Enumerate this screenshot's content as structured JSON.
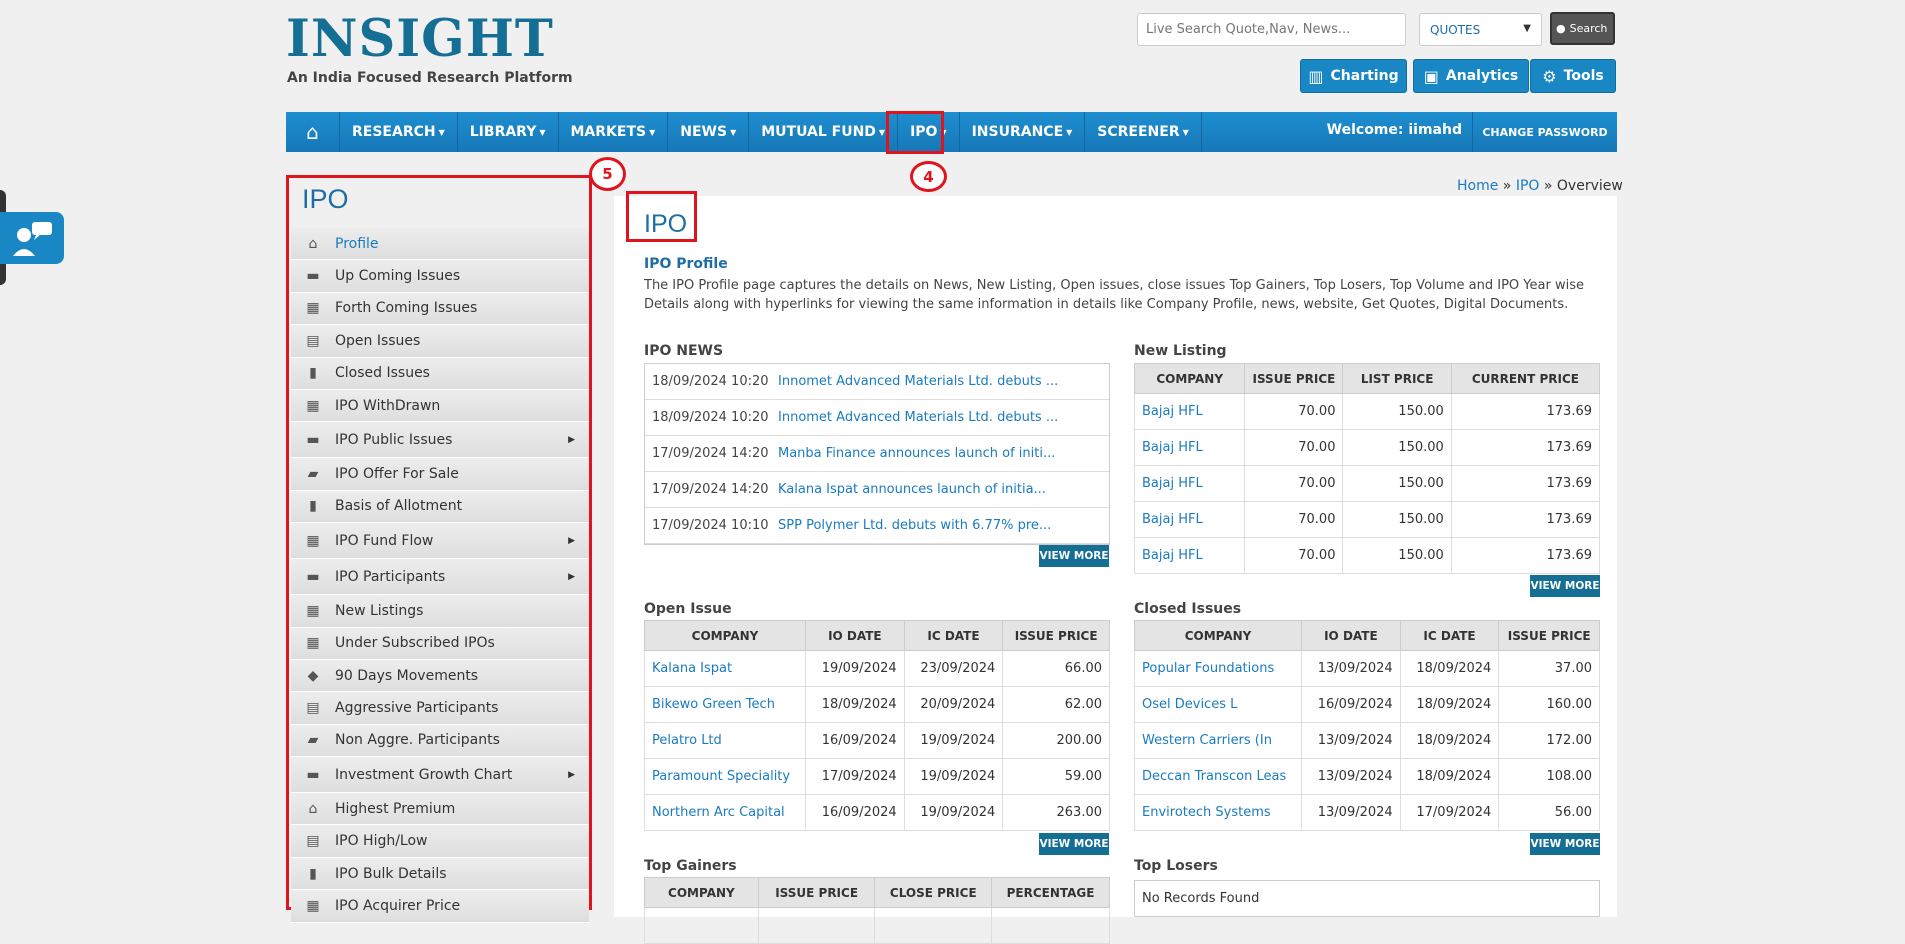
{
  "header": {
    "logo": "INSIGHT",
    "tagline": "An India Focused Research Platform",
    "search_placeholder": "Live Search Quote,Nav, News...",
    "select_value": "QUOTES",
    "search_label": "Search",
    "tools": [
      {
        "label": "Charting",
        "icon": "bar-chart-icon"
      },
      {
        "label": "Analytics",
        "icon": "analytics-icon"
      },
      {
        "label": "Tools",
        "icon": "gear-icon"
      }
    ]
  },
  "nav": {
    "items": [
      "RESEARCH",
      "LIBRARY",
      "MARKETS",
      "NEWS",
      "MUTUAL FUND",
      "IPO",
      "INSURANCE",
      "SCREENER"
    ],
    "welcome": "Welcome: iimahd",
    "change_password": "CHANGE PASSWORD"
  },
  "annotations": {
    "nav_marker": "4",
    "sidebar_marker": "5"
  },
  "breadcrumb": {
    "home": "Home",
    "ipo": "IPO",
    "current": "Overview",
    "sep": "»"
  },
  "sidebar": {
    "title": "IPO",
    "items": [
      {
        "label": "Profile",
        "icon": "home-icon",
        "sub": false
      },
      {
        "label": "Up Coming Issues",
        "icon": "folder-icon",
        "sub": false
      },
      {
        "label": "Forth Coming Issues",
        "icon": "calendar-icon",
        "sub": false
      },
      {
        "label": "Open Issues",
        "icon": "document-icon",
        "sub": false
      },
      {
        "label": "Closed Issues",
        "icon": "bar-chart-icon",
        "sub": false
      },
      {
        "label": "IPO WithDrawn",
        "icon": "grid-icon",
        "sub": false
      },
      {
        "label": "IPO Public Issues",
        "icon": "folder-icon",
        "sub": true
      },
      {
        "label": "IPO Offer For Sale",
        "icon": "bookmark-icon",
        "sub": false
      },
      {
        "label": "Basis of Allotment",
        "icon": "bar-chart-icon",
        "sub": false
      },
      {
        "label": "IPO Fund Flow",
        "icon": "grid-icon",
        "sub": true
      },
      {
        "label": "IPO Participants",
        "icon": "folder-icon",
        "sub": true
      },
      {
        "label": "New Listings",
        "icon": "grid-icon",
        "sub": false
      },
      {
        "label": "Under Subscribed IPOs",
        "icon": "calendar-icon",
        "sub": false
      },
      {
        "label": "90 Days Movements",
        "icon": "tag-icon",
        "sub": false
      },
      {
        "label": "Aggressive Participants",
        "icon": "document-icon",
        "sub": false
      },
      {
        "label": "Non Aggre. Participants",
        "icon": "bookmark-icon",
        "sub": false
      },
      {
        "label": "Investment Growth Chart",
        "icon": "folder-icon",
        "sub": true
      },
      {
        "label": "Highest Premium",
        "icon": "home-icon",
        "sub": false
      },
      {
        "label": "IPO High/Low",
        "icon": "document-icon",
        "sub": false
      },
      {
        "label": "IPO Bulk Details",
        "icon": "bar-chart-icon",
        "sub": false
      },
      {
        "label": "IPO Acquirer Price",
        "icon": "grid-icon",
        "sub": false
      }
    ]
  },
  "content": {
    "title": "IPO",
    "profile_heading": "IPO Profile",
    "profile_text": "The IPO Profile page captures the details on News, New Listing, Open issues, close issues Top Gainers, Top Losers, Top Volume and IPO Year wise Details along with hyperlinks for viewing the same information in details like Company Profile, news, website, Get Quotes, Digital Documents.",
    "view_more": "VIEW MORE",
    "news": {
      "heading": "IPO NEWS",
      "rows": [
        {
          "date": "18/09/2024 10:20",
          "title": "Innomet Advanced Materials Ltd. debuts ..."
        },
        {
          "date": "18/09/2024 10:20",
          "title": "Innomet Advanced Materials Ltd. debuts ..."
        },
        {
          "date": "17/09/2024 14:20",
          "title": "Manba Finance announces launch of initi..."
        },
        {
          "date": "17/09/2024 14:20",
          "title": "Kalana Ispat announces launch of initia..."
        },
        {
          "date": "17/09/2024 10:10",
          "title": "SPP Polymer Ltd. debuts with 6.77% pre..."
        }
      ]
    },
    "new_listing": {
      "heading": "New Listing",
      "columns": [
        "COMPANY",
        "ISSUE PRICE",
        "LIST PRICE",
        "CURRENT PRICE"
      ],
      "rows": [
        [
          "Bajaj HFL",
          "70.00",
          "150.00",
          "173.69"
        ],
        [
          "Bajaj HFL",
          "70.00",
          "150.00",
          "173.69"
        ],
        [
          "Bajaj HFL",
          "70.00",
          "150.00",
          "173.69"
        ],
        [
          "Bajaj HFL",
          "70.00",
          "150.00",
          "173.69"
        ],
        [
          "Bajaj HFL",
          "70.00",
          "150.00",
          "173.69"
        ]
      ]
    },
    "open_issue": {
      "heading": "Open Issue",
      "columns": [
        "COMPANY",
        "IO DATE",
        "IC DATE",
        "ISSUE PRICE"
      ],
      "rows": [
        [
          "Kalana Ispat",
          "19/09/2024",
          "23/09/2024",
          "66.00"
        ],
        [
          "Bikewo Green Tech",
          "18/09/2024",
          "20/09/2024",
          "62.00"
        ],
        [
          "Pelatro Ltd",
          "16/09/2024",
          "19/09/2024",
          "200.00"
        ],
        [
          "Paramount Speciality",
          "17/09/2024",
          "19/09/2024",
          "59.00"
        ],
        [
          "Northern Arc Capital",
          "16/09/2024",
          "19/09/2024",
          "263.00"
        ]
      ]
    },
    "closed_issues": {
      "heading": "Closed Issues",
      "columns": [
        "COMPANY",
        "IO DATE",
        "IC DATE",
        "ISSUE PRICE"
      ],
      "rows": [
        [
          "Popular Foundations",
          "13/09/2024",
          "18/09/2024",
          "37.00"
        ],
        [
          "Osel Devices L",
          "16/09/2024",
          "18/09/2024",
          "160.00"
        ],
        [
          "Western Carriers (In",
          "13/09/2024",
          "18/09/2024",
          "172.00"
        ],
        [
          "Deccan Transcon Leas",
          "13/09/2024",
          "18/09/2024",
          "108.00"
        ],
        [
          "Envirotech Systems",
          "13/09/2024",
          "17/09/2024",
          "56.00"
        ]
      ]
    },
    "top_gainers": {
      "heading": "Top Gainers",
      "columns": [
        "COMPANY",
        "ISSUE PRICE",
        "CLOSE PRICE",
        "PERCENTAGE"
      ]
    },
    "top_losers": {
      "heading": "Top Losers",
      "empty": "No Records Found"
    }
  }
}
